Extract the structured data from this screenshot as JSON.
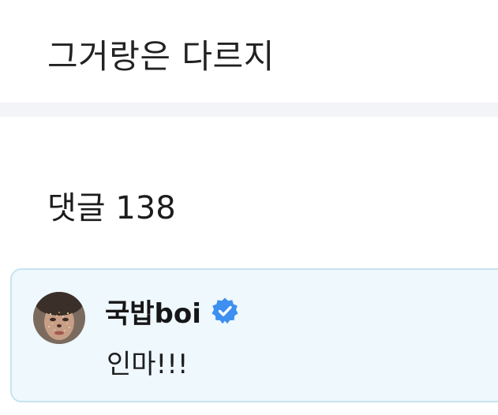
{
  "post": {
    "body": "그거랑은 다르지"
  },
  "comments": {
    "heading": "댓글 138",
    "items": [
      {
        "author": "국밥boi",
        "verified": true,
        "avatar_icon": "user-avatar",
        "text": "인마!!!"
      }
    ]
  },
  "colors": {
    "card_background": "#eef8fd",
    "card_border": "#c7e3f1",
    "verified_badge": "#3d8ff0",
    "divider": "#f3f4f8"
  }
}
